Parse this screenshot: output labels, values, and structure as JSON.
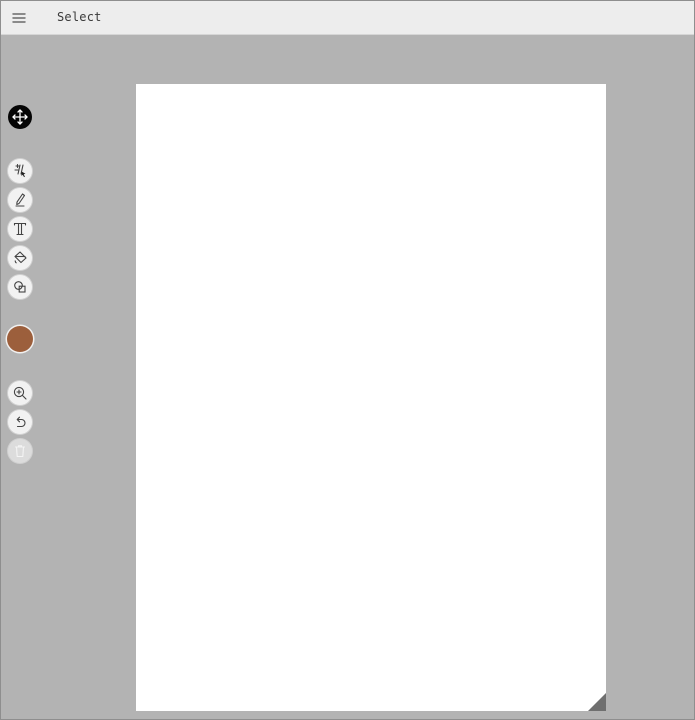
{
  "app": {
    "mode_label": "Select"
  },
  "toolbar": {
    "tools": [
      {
        "id": "move",
        "icon": "move-arrows-icon",
        "active": true
      },
      {
        "id": "select",
        "icon": "select-pointer-icon",
        "active": false
      },
      {
        "id": "pen",
        "icon": "pen-icon",
        "active": false
      },
      {
        "id": "text",
        "icon": "text-icon",
        "active": false
      },
      {
        "id": "fill",
        "icon": "paint-bucket-icon",
        "active": false
      },
      {
        "id": "shapes",
        "icon": "shapes-icon",
        "active": false
      }
    ],
    "current_color": "#9c5f3c",
    "actions": [
      {
        "id": "zoom",
        "icon": "zoom-in-icon",
        "enabled": true
      },
      {
        "id": "undo",
        "icon": "undo-icon",
        "enabled": true
      },
      {
        "id": "delete",
        "icon": "trash-icon",
        "enabled": false
      }
    ]
  },
  "colors": {
    "workspace": "#b3b3b3",
    "topbar": "#ededed",
    "page": "#ffffff",
    "active_tool": "#050505"
  }
}
